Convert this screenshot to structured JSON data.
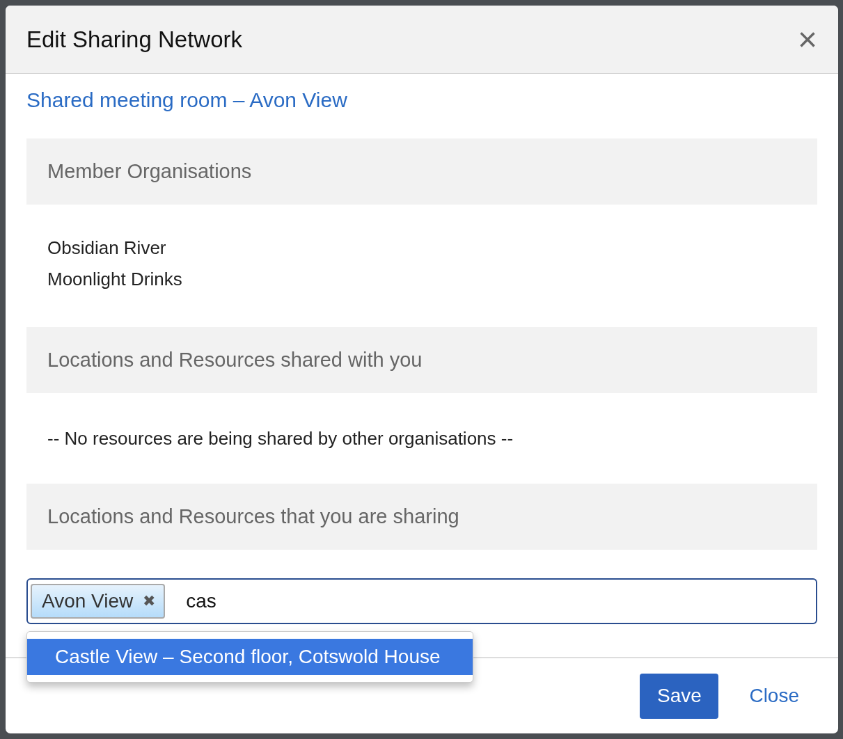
{
  "dialog": {
    "title": "Edit Sharing Network",
    "close_icon": "×"
  },
  "network_link": "Shared meeting room – Avon View",
  "sections": [
    {
      "heading": "Member Organisations",
      "kind": "list",
      "items": [
        "Obsidian River",
        "Moonlight Drinks"
      ]
    },
    {
      "heading": "Locations and Resources shared with you",
      "kind": "empty",
      "message": "-- No resources are being shared by other organisations --"
    },
    {
      "heading": "Locations and Resources that you are sharing",
      "kind": "picker",
      "tags": [
        {
          "label": "Avon View",
          "remove": "✖"
        }
      ],
      "value": "cas",
      "suggestions": [
        {
          "label": "Castle View – Second floor, Cotswold House",
          "selected": true
        }
      ]
    }
  ],
  "buttons": {
    "save": "Save",
    "close": "Close"
  }
}
